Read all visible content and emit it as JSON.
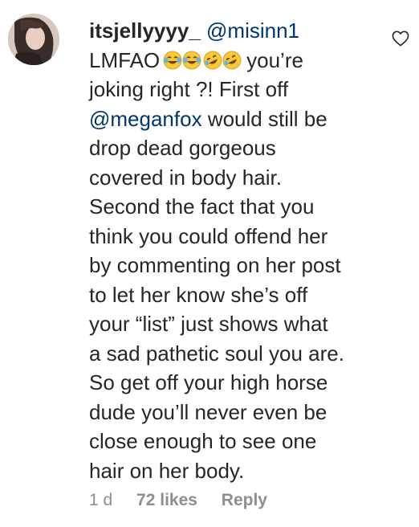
{
  "comment": {
    "username": "itsjellyyyy_",
    "reply_mention": "@misinn1",
    "first_word": "LMFAO",
    "emoji_names": [
      "joy-emoji",
      "joy-emoji",
      "rofl-emoji",
      "rofl-emoji"
    ],
    "after_emoji": "you’re",
    "lines": [
      "joking right ?! First off",
      "",
      "drop dead gorgeous",
      "covered in body hair.",
      "Second the fact that you",
      "think you could offend her",
      "by commenting on her post",
      "to let her know she’s off",
      "your “list” just shows what",
      "a sad pathetic soul you are.",
      "So get off your high horse",
      "dude you’ll never even be",
      "close enough to see one",
      "hair on her body."
    ],
    "mention_megan": "@meganfox",
    "mention_megan_after": "would still be"
  },
  "meta": {
    "time": "1 d",
    "likes": "72 likes",
    "reply": "Reply"
  },
  "icons": {
    "heart": "heart-outline-icon",
    "avatar": "user-avatar"
  }
}
